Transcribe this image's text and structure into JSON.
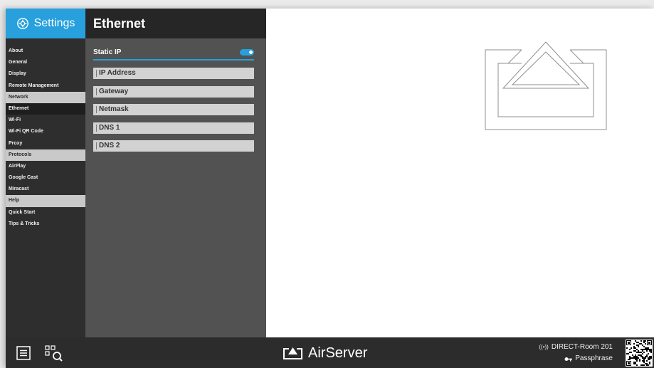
{
  "sidebar": {
    "title": "Settings",
    "items": [
      {
        "label": "About",
        "type": "item"
      },
      {
        "label": "General",
        "type": "item"
      },
      {
        "label": "Display",
        "type": "item"
      },
      {
        "label": "Remote Management",
        "type": "item"
      },
      {
        "label": "Network",
        "type": "section"
      },
      {
        "label": "Ethernet",
        "type": "active"
      },
      {
        "label": "Wi-Fi",
        "type": "item"
      },
      {
        "label": "Wi-Fi QR Code",
        "type": "item"
      },
      {
        "label": "Proxy",
        "type": "item"
      },
      {
        "label": "Protocols",
        "type": "section"
      },
      {
        "label": "AirPlay",
        "type": "item"
      },
      {
        "label": "Google Cast",
        "type": "item"
      },
      {
        "label": "Miracast",
        "type": "item"
      },
      {
        "label": "Help",
        "type": "section"
      },
      {
        "label": "Quick Start",
        "type": "item"
      },
      {
        "label": "Tips & Tricks",
        "type": "item"
      }
    ]
  },
  "panel": {
    "title": "Ethernet",
    "static_ip": {
      "label": "Static IP",
      "enabled": true
    },
    "fields": [
      {
        "label": "IP Address",
        "value": ""
      },
      {
        "label": "Gateway",
        "value": ""
      },
      {
        "label": "Netmask",
        "value": ""
      },
      {
        "label": "DNS 1",
        "value": ""
      },
      {
        "label": "DNS 2",
        "value": ""
      }
    ]
  },
  "bottombar": {
    "brand": "AirServer",
    "network_name": "DIRECT-Room 201",
    "passphrase_label": "Passphrase"
  },
  "colors": {
    "accent": "#27a0dd",
    "sidebar_bg": "#2e2e2e",
    "panel_bg": "#525252",
    "bar_bg": "#2c2c2c"
  },
  "icons": {
    "settings": "gear-icon",
    "menu": "hamburger-menu-icon",
    "qr_search": "qr-search-icon",
    "brand": "airserver-logo-icon",
    "wireless": "wireless-signal-icon",
    "passphrase": "key-icon",
    "cast": "cast-screen-icon"
  }
}
